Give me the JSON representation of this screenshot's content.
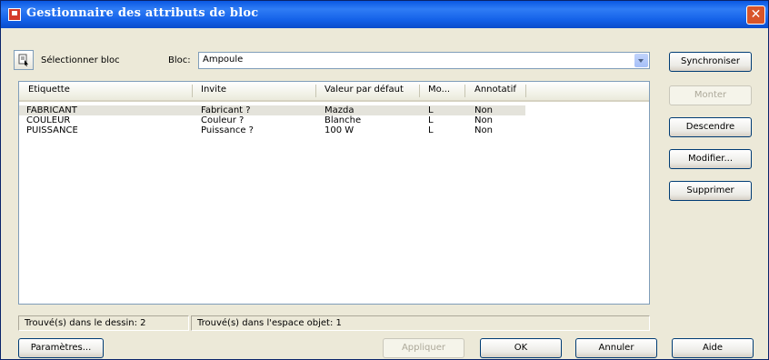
{
  "window": {
    "title": "Gestionnaire des attributs de bloc",
    "close_glyph": "✕"
  },
  "toolbar": {
    "select_block_label": "Sélectionner bloc",
    "block_label": "Bloc:",
    "block_value": "Ampoule"
  },
  "table": {
    "columns": [
      "Etiquette",
      "Invite",
      "Valeur par défaut",
      "Mo...",
      "Annotatif"
    ],
    "rows": [
      [
        "FABRICANT",
        "Fabricant ?",
        "Mazda",
        "L",
        "Non"
      ],
      [
        "COULEUR",
        "Couleur ?",
        "Blanche",
        "L",
        "Non"
      ],
      [
        "PUISSANCE",
        "Puissance ?",
        "100 W",
        "L",
        "Non"
      ]
    ],
    "selected_row": 0
  },
  "side_buttons": {
    "sync": "Synchroniser",
    "up": "Monter",
    "down": "Descendre",
    "edit": "Modifier...",
    "delete": "Supprimer"
  },
  "status": {
    "in_drawing": "Trouvé(s) dans le dessin: 2",
    "in_space": "Trouvé(s) dans l'espace objet: 1"
  },
  "bottom_buttons": {
    "settings": "Paramètres...",
    "apply": "Appliquer",
    "ok": "OK",
    "cancel": "Annuler",
    "help": "Aide"
  },
  "colors": {
    "title_bar": "#0A58E3",
    "dialog_bg": "#ECE9D8",
    "close_button": "#D8552A"
  },
  "icons": [
    "block-app-icon",
    "close-icon",
    "select-block-icon",
    "chevron-down-icon"
  ]
}
